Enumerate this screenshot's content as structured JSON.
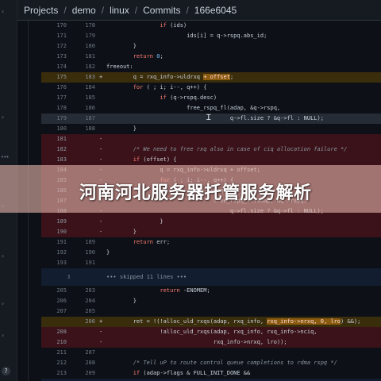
{
  "breadcrumb": {
    "items": [
      "Projects",
      "demo",
      "linux",
      "Commits",
      "166e6045"
    ],
    "separator": "/"
  },
  "banner": {
    "title": "河南河北服务器托管服务解析"
  },
  "diff": {
    "rows": [
      {
        "kind": "ctx",
        "a": "170",
        "b": "178",
        "m": "",
        "code": "                if (ids)"
      },
      {
        "kind": "ctx",
        "a": "171",
        "b": "179",
        "m": "",
        "code": "                        ids[i] = q->rspq.abs_id;"
      },
      {
        "kind": "ctx",
        "a": "172",
        "b": "180",
        "m": "",
        "code": "        }"
      },
      {
        "kind": "ctx",
        "a": "173",
        "b": "181",
        "m": "",
        "code": "        return 0;"
      },
      {
        "kind": "ctx",
        "a": "174",
        "b": "182",
        "m": "",
        "code": "freeout:"
      },
      {
        "kind": "add",
        "a": "175",
        "b": "183",
        "m": "+",
        "code": "        q = rxq_info->uldrxq ",
        "hl": "+ offset",
        "tail": ";"
      },
      {
        "kind": "ctx",
        "a": "176",
        "b": "184",
        "m": "",
        "code": "        for ( ; i; i--, q++) {"
      },
      {
        "kind": "ctx",
        "a": "177",
        "b": "185",
        "m": "",
        "code": "                if (q->rspq.desc)"
      },
      {
        "kind": "ctx",
        "a": "178",
        "b": "186",
        "m": "",
        "code": "                        free_rspq_fl(adap, &q->rspq,"
      },
      {
        "kind": "sel",
        "a": "179",
        "b": "187",
        "m": "",
        "code": "                                     q->fl.size ? &q->fl : NULL);"
      },
      {
        "kind": "ctx",
        "a": "180",
        "b": "188",
        "m": "",
        "code": "        }"
      },
      {
        "kind": "del",
        "a": "181",
        "b": "",
        "m": "-",
        "code": ""
      },
      {
        "kind": "del",
        "a": "182",
        "b": "",
        "m": "-",
        "code": "        /* We need to free rxq also in case of ciq allocation failure */"
      },
      {
        "kind": "del",
        "a": "183",
        "b": "",
        "m": "-",
        "code": "        if (offset) {"
      },
      {
        "kind": "del",
        "a": "184",
        "b": "",
        "m": "-",
        "code": "                q = rxq_info->uldrxq + offset;"
      },
      {
        "kind": "del",
        "a": "185",
        "b": "",
        "m": "-",
        "code": "                for ( ; i; i--, q++) {"
      },
      {
        "kind": "del",
        "a": "186",
        "b": "",
        "m": "-",
        "code": "                        if (q->rspq.desc)"
      },
      {
        "kind": "del",
        "a": "187",
        "b": "",
        "m": "-",
        "code": "                                free_rspq_fl(adap, &q->rspq,"
      },
      {
        "kind": "del",
        "a": "188",
        "b": "",
        "m": "-",
        "code": "                                     q->fl.size ? &q->fl : NULL);"
      },
      {
        "kind": "del",
        "a": "189",
        "b": "",
        "m": "-",
        "code": "                }"
      },
      {
        "kind": "del",
        "a": "190",
        "b": "",
        "m": "-",
        "code": "        }"
      },
      {
        "kind": "ctx",
        "a": "191",
        "b": "189",
        "m": "",
        "code": "        return err;"
      },
      {
        "kind": "ctx",
        "a": "192",
        "b": "190",
        "m": "",
        "code": "}"
      },
      {
        "kind": "ctx",
        "a": "193",
        "b": "191",
        "m": "",
        "code": ""
      },
      {
        "kind": "hunk",
        "text": "••• skipped 11 lines •••"
      },
      {
        "kind": "ctx",
        "a": "205",
        "b": "203",
        "m": "",
        "code": "                return -ENOMEM;"
      },
      {
        "kind": "ctx",
        "a": "206",
        "b": "204",
        "m": "",
        "code": "        }"
      },
      {
        "kind": "ctx",
        "a": "207",
        "b": "205",
        "m": "",
        "code": ""
      },
      {
        "kind": "add",
        "a": "",
        "b": "206",
        "m": "+",
        "code": "        ret = !(!alloc_uld_rxqs(adap, rxq_info, ",
        "hl": "rxq_info->nrxq, 0, lro",
        "tail": ") &&);"
      },
      {
        "kind": "del",
        "a": "208",
        "b": "",
        "m": "-",
        "code": "                !alloc_uld_rxqs(adap, rxq_info, rxq_info->nciq,"
      },
      {
        "kind": "del",
        "a": "210",
        "b": "",
        "m": "-",
        "code": "                                rxq_info->nrxq, lro));"
      },
      {
        "kind": "ctx",
        "a": "211",
        "b": "207",
        "m": "",
        "code": ""
      },
      {
        "kind": "ctx",
        "a": "212",
        "b": "208",
        "m": "",
        "code": "        /* Tell uP to route control queue completions to rdma rspq */"
      },
      {
        "kind": "ctx",
        "a": "213",
        "b": "209",
        "m": "",
        "code": "        if (adap->flags & FULL_INIT_DONE &&"
      },
      {
        "kind": "hunk",
        "text": "••• skipped 484 lines •••"
      }
    ]
  },
  "sidebar": {
    "help_label": "?"
  },
  "colors": {
    "accent_add": "#8a5a0f",
    "accent_del": "#8e1519",
    "banner_tint": "#e2b2a8"
  }
}
